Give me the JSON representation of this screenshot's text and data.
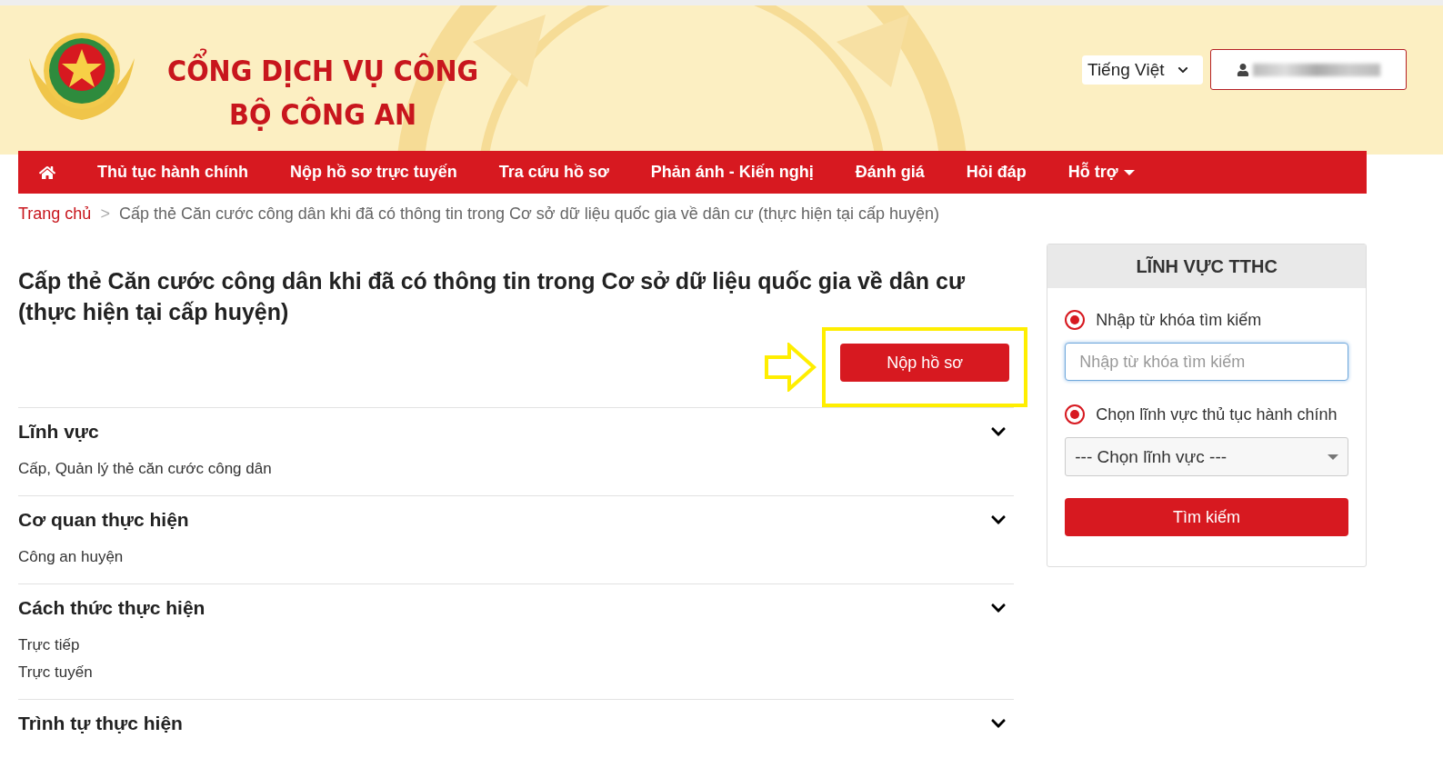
{
  "header": {
    "title_lines": [
      "CỔNG DỊCH VỤ CÔNG",
      "BỘ CÔNG AN"
    ],
    "language": "Tiếng Việt"
  },
  "nav": {
    "items": [
      {
        "kind": "home"
      },
      {
        "kind": "link",
        "label": "Thủ tục hành chính"
      },
      {
        "kind": "link",
        "label": "Nộp hồ sơ trực tuyến"
      },
      {
        "kind": "link",
        "label": "Tra cứu hồ sơ"
      },
      {
        "kind": "link",
        "label": "Phản ánh - Kiến nghị"
      },
      {
        "kind": "link",
        "label": "Đánh giá"
      },
      {
        "kind": "link",
        "label": "Hỏi đáp"
      },
      {
        "kind": "dropdown",
        "label": "Hỗ trợ"
      }
    ]
  },
  "breadcrumb": {
    "home": "Trang chủ",
    "separator": ">",
    "current": "Cấp thẻ Căn cước công dân khi đã có thông tin trong Cơ sở dữ liệu quốc gia về dân cư (thực hiện tại cấp huyện)"
  },
  "procedure": {
    "title": "Cấp thẻ Căn cước công dân khi đã có thông tin trong Cơ sở dữ liệu quốc gia về dân cư (thực hiện tại cấp huyện)",
    "submit_button": "Nộp hồ sơ",
    "sections": [
      {
        "title": "Lĩnh vực",
        "items": [
          "Cấp, Quản lý thẻ căn cước công dân"
        ]
      },
      {
        "title": "Cơ quan thực hiện",
        "items": [
          "Công an huyện"
        ]
      },
      {
        "title": "Cách thức thực hiện",
        "items": [
          "Trực tiếp",
          "Trực tuyến"
        ]
      },
      {
        "title": "Trình tự thực hiện"
      }
    ]
  },
  "sidebar": {
    "title": "LĨNH VỰC TTHC",
    "options": [
      {
        "label": "Nhập từ khóa tìm kiếm",
        "selected": true
      },
      {
        "label": "Chọn lĩnh vực thủ tục hành chính",
        "selected": true
      }
    ],
    "search": {
      "placeholder": "Nhập từ khóa tìm kiếm"
    },
    "select": {
      "value": "--- Chọn lĩnh vực ---"
    },
    "button": "Tìm kiếm"
  }
}
